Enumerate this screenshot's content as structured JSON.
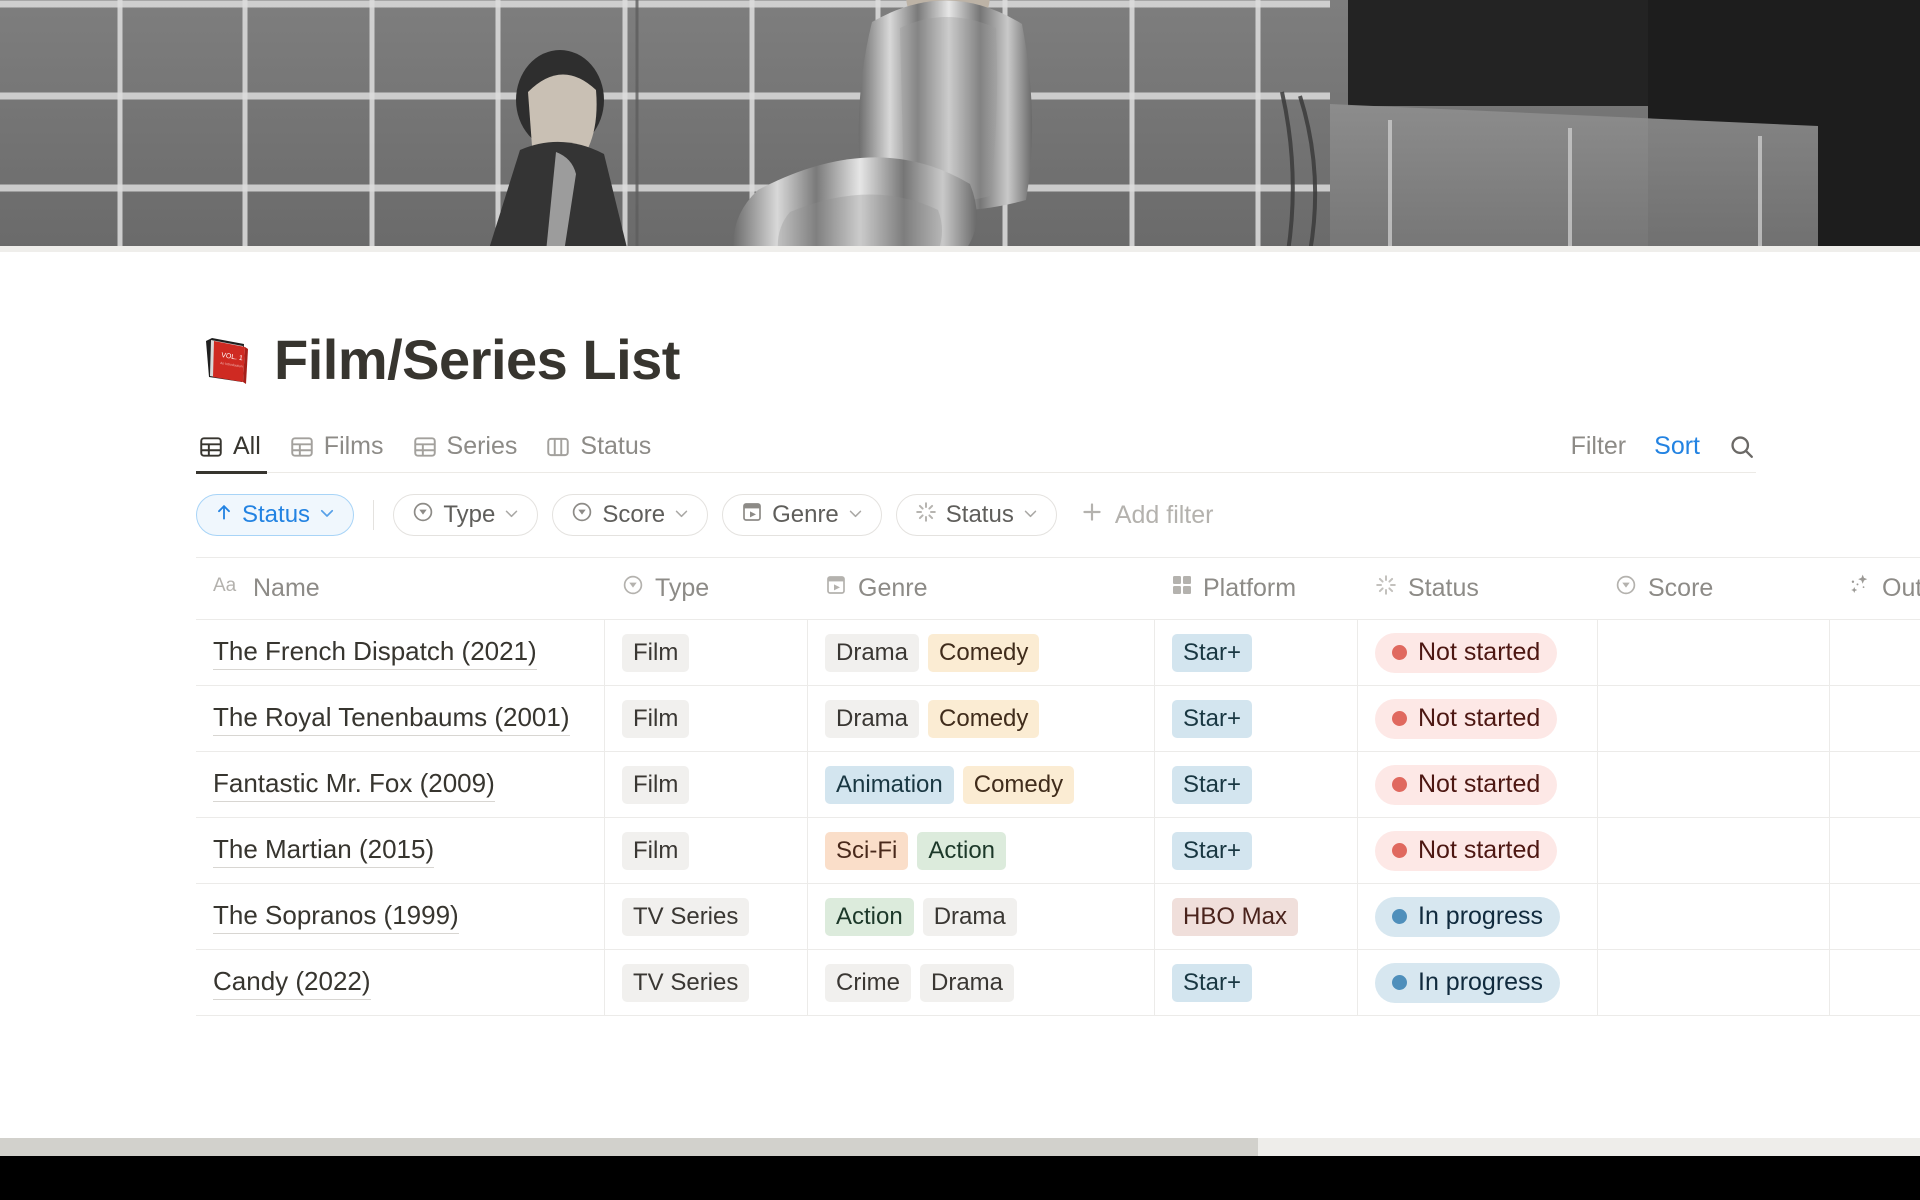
{
  "cover": {
    "alt": "black and white photo of two people behind a wire grid fence"
  },
  "header": {
    "emoji_icon": "closed-book-emoji",
    "title": "Film/Series List"
  },
  "tabs": [
    {
      "label": "All",
      "icon": "table-icon",
      "active": true
    },
    {
      "label": "Films",
      "icon": "table-icon",
      "active": false
    },
    {
      "label": "Series",
      "icon": "table-icon",
      "active": false
    },
    {
      "label": "Status",
      "icon": "board-icon",
      "active": false
    }
  ],
  "toolbar": {
    "filter_label": "Filter",
    "sort_label": "Sort",
    "search_icon": "search-icon"
  },
  "filter_bar": {
    "sort_chip": {
      "label": "Status",
      "icon": "arrow-up-icon",
      "caret": "chevron-down-icon"
    },
    "chips": [
      {
        "label": "Type",
        "icon": "select-icon"
      },
      {
        "label": "Score",
        "icon": "select-icon"
      },
      {
        "label": "Genre",
        "icon": "clapper-icon"
      },
      {
        "label": "Status",
        "icon": "spinner-icon"
      }
    ],
    "add_filter_label": "Add filter",
    "add_filter_icon": "plus-icon"
  },
  "table": {
    "columns": [
      {
        "label": "Name",
        "icon": "text-aa-icon"
      },
      {
        "label": "Type",
        "icon": "select-icon"
      },
      {
        "label": "Genre",
        "icon": "clapper-icon"
      },
      {
        "label": "Platform",
        "icon": "multi-select-icon"
      },
      {
        "label": "Status",
        "icon": "spinner-icon"
      },
      {
        "label": "Score",
        "icon": "select-icon"
      },
      {
        "label": "Out",
        "icon": "sparkles-icon"
      }
    ],
    "rows": [
      {
        "name": "The French Dispatch (2021)",
        "type": "Film",
        "type_color": "gray",
        "genres": [
          {
            "label": "Drama",
            "color": "gray"
          },
          {
            "label": "Comedy",
            "color": "yellow"
          }
        ],
        "platform": "Star+",
        "platform_color": "blue",
        "status": "Not started",
        "status_color": "red",
        "score": "",
        "output": ""
      },
      {
        "name": "The Royal Tenenbaums (2001)",
        "type": "Film",
        "type_color": "gray",
        "genres": [
          {
            "label": "Drama",
            "color": "gray"
          },
          {
            "label": "Comedy",
            "color": "yellow"
          }
        ],
        "platform": "Star+",
        "platform_color": "blue",
        "status": "Not started",
        "status_color": "red",
        "score": "",
        "output": ""
      },
      {
        "name": "Fantastic Mr. Fox (2009)",
        "type": "Film",
        "type_color": "gray",
        "genres": [
          {
            "label": "Animation",
            "color": "blue"
          },
          {
            "label": "Comedy",
            "color": "yellow"
          }
        ],
        "platform": "Star+",
        "platform_color": "blue",
        "status": "Not started",
        "status_color": "red",
        "score": "",
        "output": ""
      },
      {
        "name": "The Martian (2015)",
        "type": "Film",
        "type_color": "gray",
        "genres": [
          {
            "label": "Sci-Fi",
            "color": "orange"
          },
          {
            "label": "Action",
            "color": "green"
          }
        ],
        "platform": "Star+",
        "platform_color": "blue",
        "status": "Not started",
        "status_color": "red",
        "score": "",
        "output": ""
      },
      {
        "name": "The Sopranos (1999)",
        "type": "TV Series",
        "type_color": "gray",
        "genres": [
          {
            "label": "Action",
            "color": "green"
          },
          {
            "label": "Drama",
            "color": "gray"
          }
        ],
        "platform": "HBO Max",
        "platform_color": "pink",
        "status": "In progress",
        "status_color": "blue",
        "score": "",
        "output": ""
      },
      {
        "name": "Candy (2022)",
        "type": "TV Series",
        "type_color": "gray",
        "genres": [
          {
            "label": "Crime",
            "color": "gray"
          },
          {
            "label": "Drama",
            "color": "gray"
          }
        ],
        "platform": "Star+",
        "platform_color": "blue",
        "status": "In progress",
        "status_color": "blue",
        "score": "",
        "output": ""
      }
    ]
  },
  "colors": {
    "accent_blue": "#2383e2",
    "text_primary": "#37352f",
    "text_muted": "#8d8b87",
    "status_not_started_bg": "#fde8e6",
    "status_not_started_dot": "#e0695f",
    "status_in_progress_bg": "#d7e7f0",
    "status_in_progress_dot": "#4f8fbb"
  }
}
